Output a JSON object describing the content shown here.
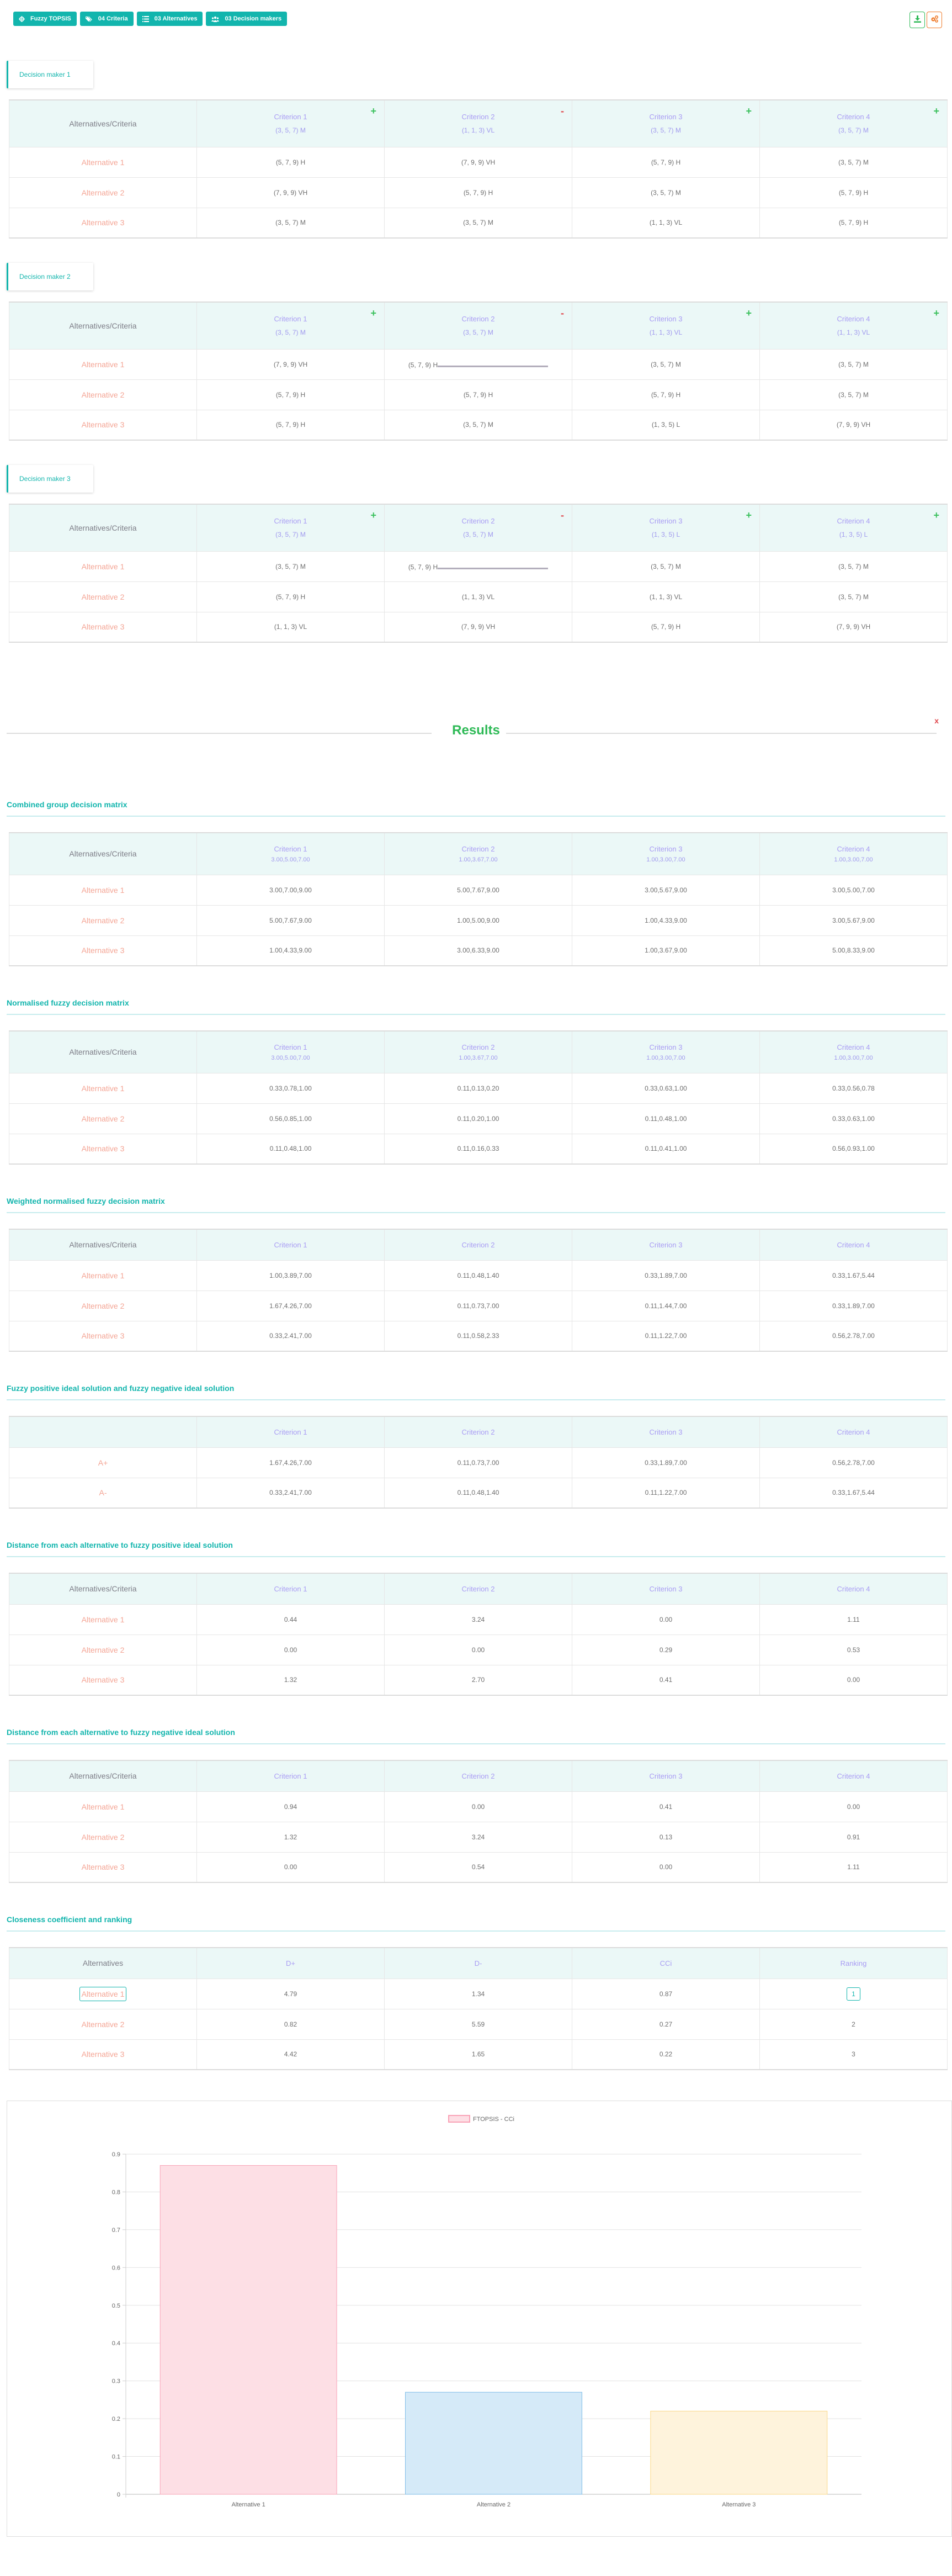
{
  "toolbar": {
    "method": {
      "label": "Fuzzy TOPSIS",
      "icon": "crosshair-icon"
    },
    "criteria": {
      "label": "04 Criteria",
      "icon": "tags-icon"
    },
    "alternatives": {
      "label": "03 Alternatives",
      "icon": "list-icon"
    },
    "decision_makers": {
      "label": "03 Decision makers",
      "icon": "users-icon"
    },
    "download": {
      "icon": "download-icon"
    },
    "settings": {
      "icon": "gears-icon"
    }
  },
  "corner_label": "Alternatives/Criteria",
  "criteria": [
    {
      "name": "Criterion 1",
      "type": "+"
    },
    {
      "name": "Criterion 2",
      "type": "-"
    },
    {
      "name": "Criterion 3",
      "type": "+"
    },
    {
      "name": "Criterion 4",
      "type": "+"
    }
  ],
  "alternatives": [
    "Alternative 1",
    "Alternative 2",
    "Alternative 3"
  ],
  "decision_makers": [
    {
      "label": "Decision maker 1",
      "weights": [
        "(3, 5, 7) M",
        "(1, 1, 3) VL",
        "(3, 5, 7) M",
        "(3, 5, 7) M"
      ],
      "rows": [
        [
          "(5, 7, 9) H",
          "(7, 9, 9) VH",
          "(5, 7, 9) H",
          "(3, 5, 7) M"
        ],
        [
          "(7, 9, 9) VH",
          "(5, 7, 9) H",
          "(3, 5, 7) M",
          "(5, 7, 9) H"
        ],
        [
          "(3, 5, 7) M",
          "(3, 5, 7) M",
          "(1, 1, 3) VL",
          "(5, 7, 9) H"
        ]
      ]
    },
    {
      "label": "Decision maker 2",
      "weights": [
        "(3, 5, 7) M",
        "(3, 5, 7) M",
        "(1, 1, 3) VL",
        "(1, 1, 3) VL"
      ],
      "rows": [
        [
          "(7, 9, 9) VH",
          "(5, 7, 9) H",
          "(3, 5, 7) M",
          "(3, 5, 7) M"
        ],
        [
          "(5, 7, 9) H",
          "(5, 7, 9) H",
          "(5, 7, 9) H",
          "(3, 5, 7) M"
        ],
        [
          "(5, 7, 9) H",
          "(3, 5, 7) M",
          "(1, 3, 5) L",
          "(7, 9, 9) VH"
        ]
      ]
    },
    {
      "label": "Decision maker 3",
      "weights": [
        "(3, 5, 7) M",
        "(3, 5, 7) M",
        "(1, 3, 5) L",
        "(1, 3, 5) L"
      ],
      "rows": [
        [
          "(3, 5, 7) M",
          "(5, 7, 9) H",
          "(3, 5, 7) M",
          "(3, 5, 7) M"
        ],
        [
          "(5, 7, 9) H",
          "(1, 1, 3) VL",
          "(1, 1, 3) VL",
          "(3, 5, 7) M"
        ],
        [
          "(1, 1, 3) VL",
          "(7, 9, 9) VH",
          "(5, 7, 9) H",
          "(7, 9, 9) VH"
        ]
      ]
    }
  ],
  "results": {
    "title": "Results",
    "close_label": "x",
    "combined": {
      "title": "Combined group decision matrix",
      "weights": [
        "3.00,5.00,7.00",
        "1.00,3.67,7.00",
        "1.00,3.00,7.00",
        "1.00,3.00,7.00"
      ],
      "rows": [
        [
          "3.00,7.00,9.00",
          "5.00,7.67,9.00",
          "3.00,5.67,9.00",
          "3.00,5.00,7.00"
        ],
        [
          "5.00,7.67,9.00",
          "1.00,5.00,9.00",
          "1.00,4.33,9.00",
          "3.00,5.67,9.00"
        ],
        [
          "1.00,4.33,9.00",
          "3.00,6.33,9.00",
          "1.00,3.67,9.00",
          "5.00,8.33,9.00"
        ]
      ]
    },
    "normalised": {
      "title": "Normalised fuzzy decision matrix",
      "weights": [
        "3.00,5.00,7.00",
        "1.00,3.67,7.00",
        "1.00,3.00,7.00",
        "1.00,3.00,7.00"
      ],
      "rows": [
        [
          "0.33,0.78,1.00",
          "0.11,0.13,0.20",
          "0.33,0.63,1.00",
          "0.33,0.56,0.78"
        ],
        [
          "0.56,0.85,1.00",
          "0.11,0.20,1.00",
          "0.11,0.48,1.00",
          "0.33,0.63,1.00"
        ],
        [
          "0.11,0.48,1.00",
          "0.11,0.16,0.33",
          "0.11,0.41,1.00",
          "0.56,0.93,1.00"
        ]
      ]
    },
    "weighted": {
      "title": "Weighted normalised fuzzy decision matrix",
      "rows": [
        [
          "1.00,3.89,7.00",
          "0.11,0.48,1.40",
          "0.33,1.89,7.00",
          "0.33,1.67,5.44"
        ],
        [
          "1.67,4.26,7.00",
          "0.11,0.73,7.00",
          "0.11,1.44,7.00",
          "0.33,1.89,7.00"
        ],
        [
          "0.33,2.41,7.00",
          "0.11,0.58,2.33",
          "0.11,1.22,7.00",
          "0.56,2.78,7.00"
        ]
      ]
    },
    "ideal": {
      "title": "Fuzzy positive ideal solution and fuzzy negative ideal solution",
      "corner_label": "",
      "row_labels": [
        "A+",
        "A-"
      ],
      "rows": [
        [
          "1.67,4.26,7.00",
          "0.11,0.73,7.00",
          "0.33,1.89,7.00",
          "0.56,2.78,7.00"
        ],
        [
          "0.33,2.41,7.00",
          "0.11,0.48,1.40",
          "0.11,1.22,7.00",
          "0.33,1.67,5.44"
        ]
      ]
    },
    "dist_pos": {
      "title": "Distance from each alternative to fuzzy positive ideal solution",
      "rows": [
        [
          "0.44",
          "3.24",
          "0.00",
          "1.11"
        ],
        [
          "0.00",
          "0.00",
          "0.29",
          "0.53"
        ],
        [
          "1.32",
          "2.70",
          "0.41",
          "0.00"
        ]
      ]
    },
    "dist_neg": {
      "title": "Distance from each alternative to fuzzy negative ideal solution",
      "rows": [
        [
          "0.94",
          "0.00",
          "0.41",
          "0.00"
        ],
        [
          "1.32",
          "3.24",
          "0.13",
          "0.91"
        ],
        [
          "0.00",
          "0.54",
          "0.00",
          "1.11"
        ]
      ]
    },
    "closeness": {
      "title": "Closeness coefficient and ranking",
      "headers": [
        "Alternatives",
        "D+",
        "D-",
        "CCi",
        "Ranking"
      ],
      "rows": [
        [
          "Alternative 1",
          "4.79",
          "1.34",
          "0.87",
          "1"
        ],
        [
          "Alternative 2",
          "0.82",
          "5.59",
          "0.27",
          "2"
        ],
        [
          "Alternative 3",
          "4.42",
          "1.65",
          "0.22",
          "3"
        ]
      ]
    }
  },
  "colors": {
    "accent": "#12b5ad",
    "benefit": "#3cc15e",
    "cost": "#e0474c",
    "criterion_text": "#a99cf4",
    "alternative_text": "#f4a595",
    "results_title": "#2fba57"
  },
  "chart_data": {
    "type": "bar",
    "title": "",
    "legend": {
      "label": "FTOPSIS - CCi",
      "position": "top"
    },
    "categories": [
      "Alternative 1",
      "Alternative 2",
      "Alternative 3"
    ],
    "series": [
      {
        "name": "FTOPSIS - CCi",
        "values": [
          0.87,
          0.27,
          0.22
        ]
      }
    ],
    "bar_colors": [
      {
        "fill": "#fddfe5",
        "stroke": "#f9a3b7"
      },
      {
        "fill": "#d5eaf8",
        "stroke": "#7fbde8"
      },
      {
        "fill": "#fef3dc",
        "stroke": "#fbd889"
      }
    ],
    "xlabel": "",
    "ylabel": "",
    "ylim": [
      0,
      0.9
    ],
    "yticks": [
      "0",
      "0.1",
      "0.2",
      "0.3",
      "0.4",
      "0.5",
      "0.6",
      "0.7",
      "0.8",
      "0.9"
    ],
    "grid": true
  }
}
